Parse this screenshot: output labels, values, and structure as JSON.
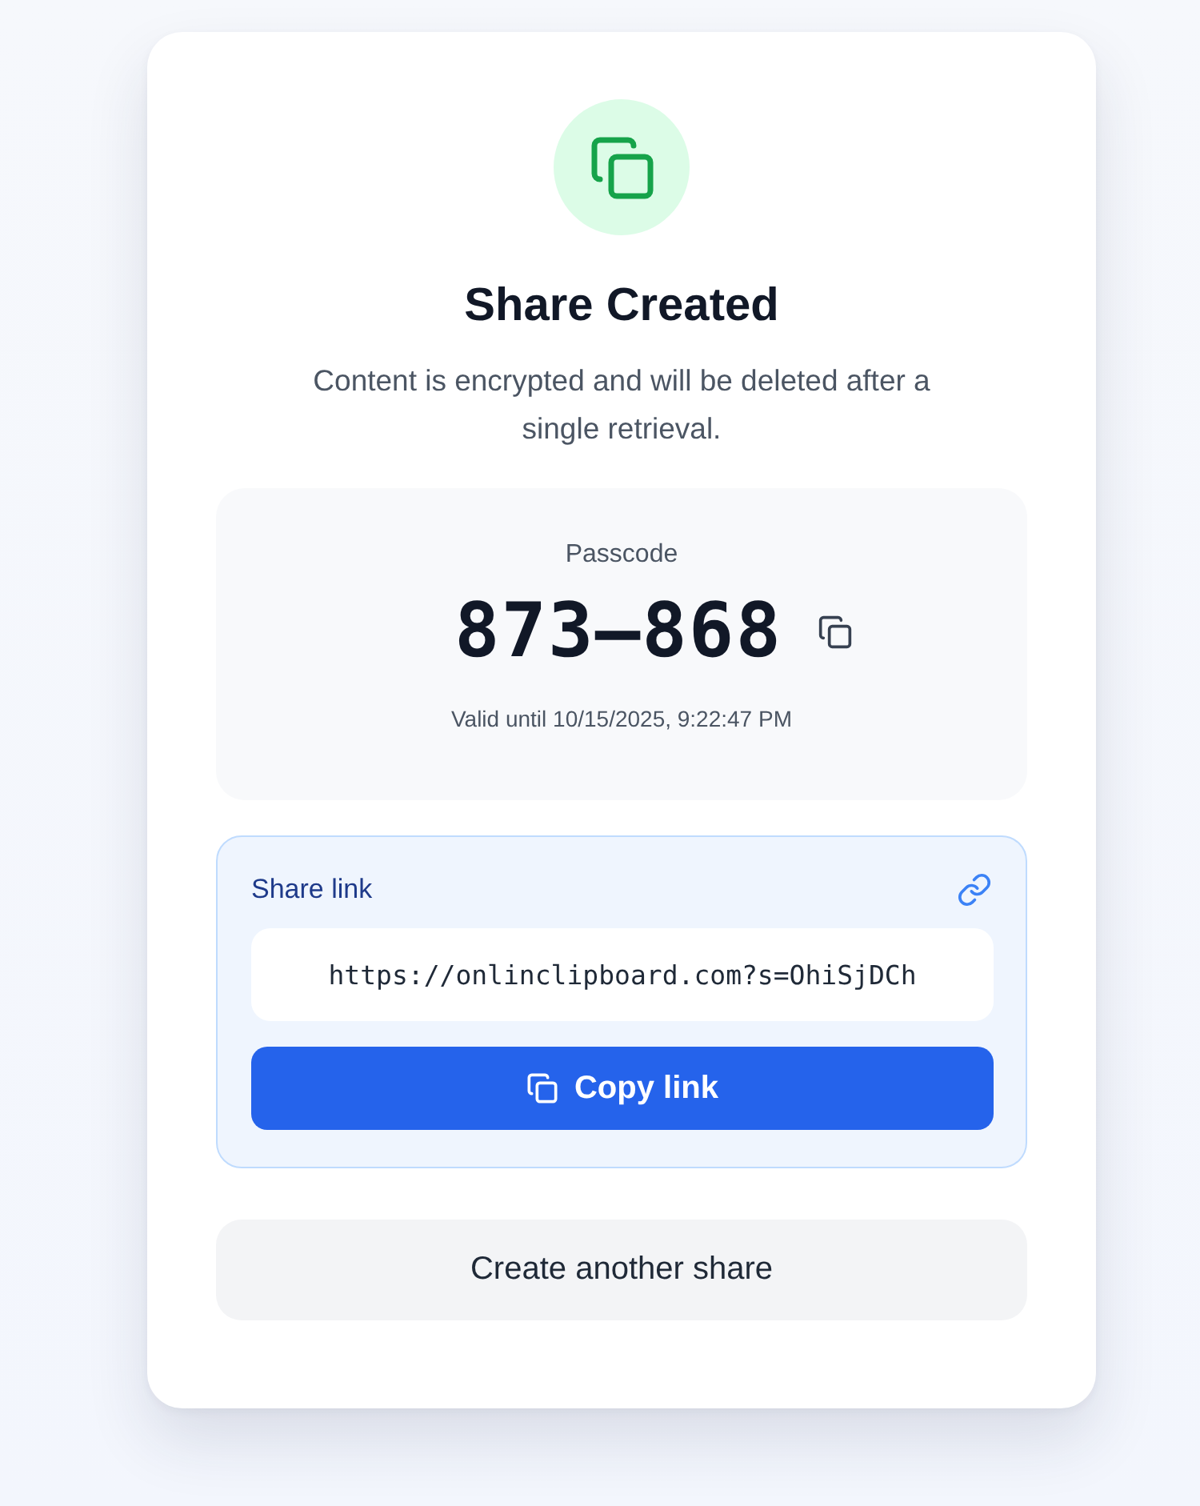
{
  "header": {
    "title": "Share Created",
    "subtitle": "Content is encrypted and will be deleted after a single retrieval."
  },
  "passcode": {
    "label": "Passcode",
    "code": "873–868",
    "validity": "Valid until 10/15/2025, 9:22:47 PM"
  },
  "share_link": {
    "label": "Share link",
    "url": "https://onlinclipboard.com?s=OhiSjDCh",
    "copy_button": "Copy link"
  },
  "create_another_button": "Create another share"
}
